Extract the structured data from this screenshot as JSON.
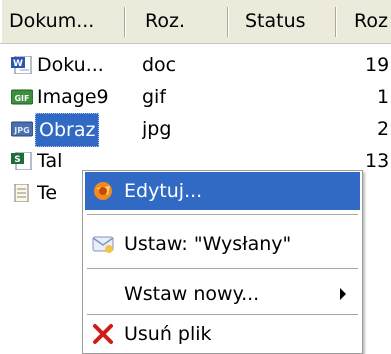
{
  "columns": [
    "Dokum...",
    "Roz.",
    "Status",
    "Roz"
  ],
  "rows": [
    {
      "name": "Doku...",
      "ext": "doc",
      "size": "19",
      "icon": "word-document-icon",
      "selected": false
    },
    {
      "name": "Image9",
      "ext": "gif",
      "size": "1",
      "icon": "gif-image-icon",
      "selected": false
    },
    {
      "name": "Obraz",
      "ext": "jpg",
      "size": "2",
      "icon": "jpg-image-icon",
      "selected": true
    },
    {
      "name": "Tal",
      "ext": "",
      "size": "13",
      "icon": "spreadsheet-icon",
      "selected": false
    },
    {
      "name": "Te",
      "ext": "",
      "size": "",
      "icon": "text-document-icon",
      "selected": false
    }
  ],
  "menu": {
    "edit": "Edytuj...",
    "set_status": "Ustaw: \"Wysłany\"",
    "insert_new": "Wstaw nowy...",
    "delete_file": "Usuń plik"
  },
  "colors": {
    "selection": "#316ac5",
    "header_bg": "#ebeadb"
  }
}
